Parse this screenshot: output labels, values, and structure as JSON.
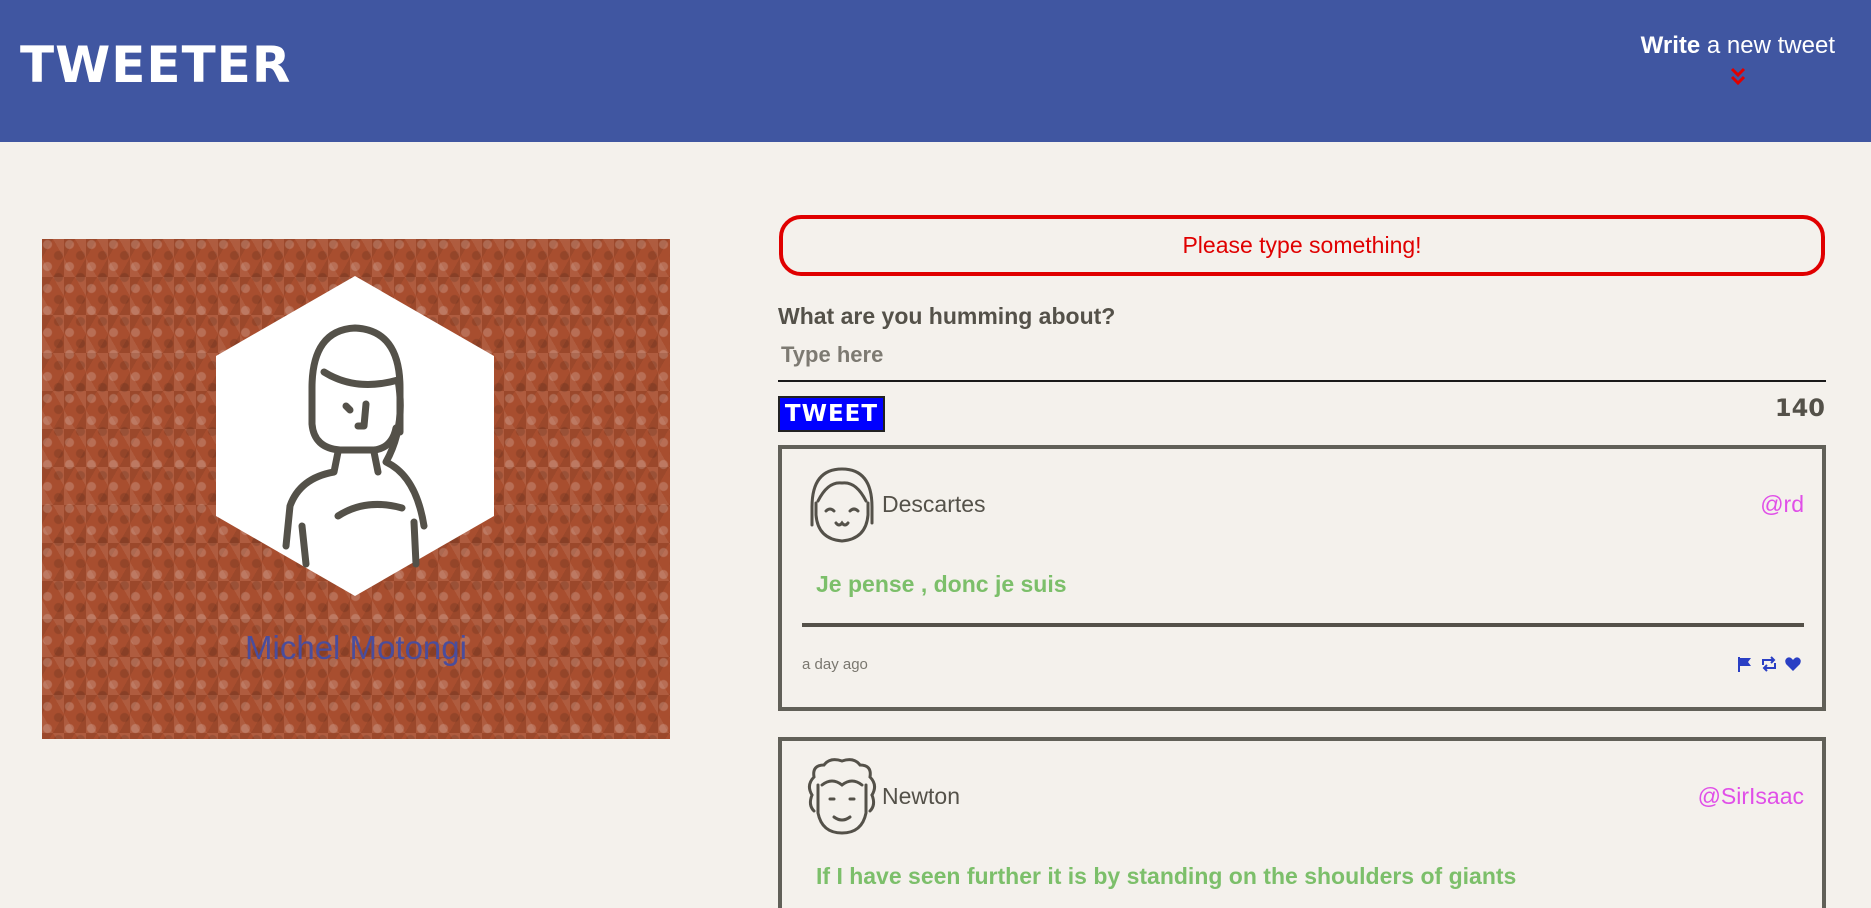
{
  "header": {
    "logo": "TWEETER",
    "compose_bold": "Write",
    "compose_rest": " a new tweet",
    "icon": "double-chevron-down-icon",
    "bg_color": "#4056a1",
    "accent_color": "#e00000"
  },
  "profile": {
    "name": "Michel Motongi",
    "avatar_icon": "woman-avatar-icon"
  },
  "composer": {
    "error": "Please type something!",
    "label": "What are you humming about?",
    "placeholder": "Type here",
    "button_label": "TWEET",
    "counter": "140"
  },
  "tweets": [
    {
      "author": "Descartes",
      "handle": "@rd",
      "content": "Je pense , donc je suis",
      "timestamp": "a day ago",
      "avatar_icon": "girl-avatar-icon",
      "actions": [
        "flag-icon",
        "retweet-icon",
        "heart-icon"
      ]
    },
    {
      "author": "Newton",
      "handle": "@SirIsaac",
      "content": "If I have seen further it is by standing on the shoulders of giants",
      "avatar_icon": "curly-hair-avatar-icon"
    }
  ]
}
